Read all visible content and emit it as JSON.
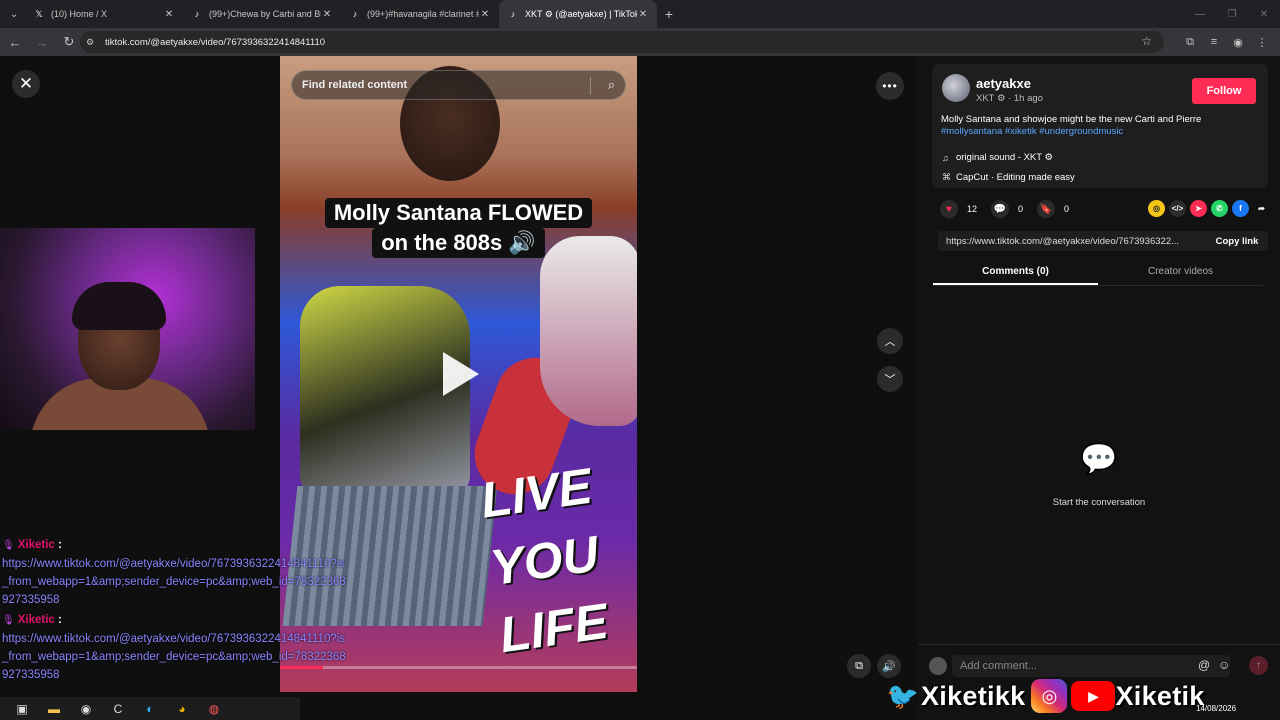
{
  "browser": {
    "tabs": [
      {
        "icon": "x-logo-icon",
        "title": "(10) Home / X",
        "active": false
      },
      {
        "icon": "tiktok-icon",
        "title": "(99+)Chewa by Carbi and Big U",
        "active": false
      },
      {
        "icon": "tiktok-icon",
        "title": "(99+)#havanagila #clarinet #ne",
        "active": false
      },
      {
        "icon": "tiktok-icon",
        "title": "XKT ⚙ (@aetyakxe) | TikTok",
        "active": true
      }
    ],
    "url": "tiktok.com/@aetyakxe/video/7673936322414841110"
  },
  "video": {
    "search_placeholder": "Find related content",
    "caption_line1": "Molly Santana FLOWED",
    "caption_line2": "on the 808s 🔊",
    "overlay_art_text": "LIVE YOU LIFE",
    "progress": 0.12
  },
  "chat": {
    "messages": [
      {
        "author": "Xiketic",
        "text": "https://www.tiktok.com/@aetyakxe/video/7673936322414841110?is_from_webapp=1&amp;sender_device=pc&amp;web_id=78322368927335958"
      },
      {
        "author": "Xiketic",
        "text": "https://www.tiktok.com/@aetyakxe/video/7673936322414841110?is_from_webapp=1&amp;sender_device=pc&amp;web_id=78322368927335958"
      }
    ]
  },
  "panel": {
    "author_name": "aetyakxe",
    "author_meta": "XKT ⚙ · 1h ago",
    "follow_label": "Follow",
    "description": "Molly Santana and showjoe might be the new Carti and Pierre",
    "hashtags": "#mollysantana #xiketik #undergroundmusic",
    "sound": "original sound - XKT ⚙",
    "capcut": "CapCut · Editing made easy",
    "likes": "12",
    "comments": "0",
    "saves": "0",
    "share_url": "https://www.tiktok.com/@aetyakxe/video/7673936322...",
    "copy_label": "Copy link",
    "tab_comments": "Comments (0)",
    "tab_creator": "Creator videos",
    "empty_text": "Start the conversation",
    "comment_placeholder": "Add comment..."
  },
  "branding": {
    "name1": "Xiketikk",
    "name2": "Xiketik"
  },
  "taskbar": {
    "date": "14/08/2026"
  },
  "colors": {
    "accent": "#fe2c55",
    "hashtag": "#5aa7ff",
    "chat_author": "#e0136b",
    "chat_link": "#8a84ff"
  }
}
